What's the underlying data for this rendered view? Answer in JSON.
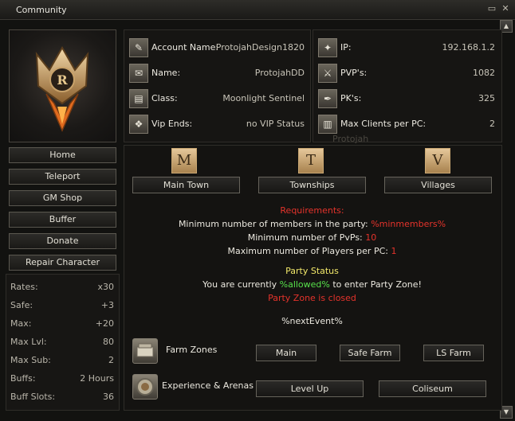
{
  "window": {
    "title": "Community"
  },
  "menu": {
    "buttons": [
      "Home",
      "Teleport",
      "GM Shop",
      "Buffer",
      "Donate",
      "Repair Character"
    ]
  },
  "stats": [
    {
      "label": "Rates:",
      "value": "x30"
    },
    {
      "label": "Safe:",
      "value": "+3"
    },
    {
      "label": "Max:",
      "value": "+20"
    },
    {
      "label": "Max Lvl:",
      "value": "80"
    },
    {
      "label": "Max Sub:",
      "value": "2"
    },
    {
      "label": "Buffs:",
      "value": "2 Hours"
    },
    {
      "label": "Buff Slots:",
      "value": "36"
    }
  ],
  "account": [
    {
      "label": "Account Name:",
      "value": "ProtojahDesign1820",
      "icon": "account-icon"
    },
    {
      "label": "Name:",
      "value": "ProtojahDD",
      "icon": "name-icon"
    },
    {
      "label": "Class:",
      "value": "Moonlight Sentinel",
      "icon": "class-icon"
    },
    {
      "label": "Vip Ends:",
      "value": "no VIP Status",
      "icon": "vip-icon"
    }
  ],
  "server": [
    {
      "label": "IP:",
      "value": "192.168.1.2",
      "icon": "ip-icon"
    },
    {
      "label": "PVP's:",
      "value": "1082",
      "icon": "pvp-icon"
    },
    {
      "label": "PK's:",
      "value": "325",
      "icon": "pk-icon"
    },
    {
      "label": "Max Clients per PC:",
      "value": "2",
      "icon": "clients-icon"
    }
  ],
  "watermark": "Protojah",
  "teleports": [
    {
      "letter": "M",
      "label": "Main Town"
    },
    {
      "letter": "T",
      "label": "Townships"
    },
    {
      "letter": "V",
      "label": "Villages"
    }
  ],
  "requirements": {
    "heading": "Requirements:",
    "members_label": "Minimum number of members in the party:",
    "members_value": "%minmembers%",
    "pvps_label": "Minimum number of PvPs:",
    "pvps_value": "10",
    "players_label": "Maximum number of Players per PC:",
    "players_value": "1"
  },
  "party": {
    "heading": "Party Status",
    "prefix": "You are currently",
    "allowed": "%allowed%",
    "suffix": "to enter Party Zone!",
    "closed": "Party Zone is closed",
    "next_event": "%nextEvent%"
  },
  "farm": {
    "label": "Farm Zones",
    "buttons": [
      "Main",
      "Safe Farm",
      "LS Farm"
    ]
  },
  "arenas": {
    "label": "Experience & Arenas",
    "buttons": [
      "Level Up",
      "Coliseum"
    ]
  },
  "colors": {
    "red": "#e5332b",
    "green": "#57e04b",
    "yellow": "#f2e86a"
  }
}
